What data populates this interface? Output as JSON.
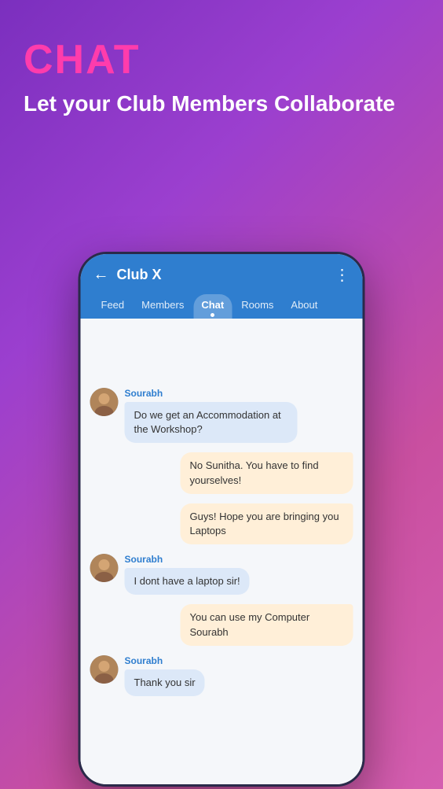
{
  "header": {
    "title": "CHAT",
    "subtitle": "Let your Club Members Collaborate"
  },
  "phone": {
    "topBar": {
      "backArrow": "←",
      "clubName": "Club X",
      "moreIcon": "⋮"
    },
    "tabs": [
      {
        "label": "Feed",
        "active": false
      },
      {
        "label": "Members",
        "active": false
      },
      {
        "label": "Chat",
        "active": true
      },
      {
        "label": "Rooms",
        "active": false
      },
      {
        "label": "About",
        "active": false
      }
    ],
    "messages": [
      {
        "id": "msg1",
        "side": "left",
        "sender": "Sourabh",
        "text": "Do we get an Accommodation at the Workshop?",
        "hasAvatar": true
      },
      {
        "id": "msg2",
        "side": "right",
        "text": "No Sunitha. You have to find yourselves!",
        "hasAvatar": false
      },
      {
        "id": "msg3",
        "side": "right",
        "text": "Guys! Hope you are bringing you Laptops",
        "hasAvatar": false
      },
      {
        "id": "msg4",
        "side": "left",
        "sender": "Sourabh",
        "text": "I dont have a laptop sir!",
        "hasAvatar": true
      },
      {
        "id": "msg5",
        "side": "right",
        "text": "You can use my Computer Sourabh",
        "hasAvatar": false
      },
      {
        "id": "msg6",
        "side": "left",
        "sender": "Sourabh",
        "text": "Thank you sir",
        "hasAvatar": true
      }
    ]
  }
}
